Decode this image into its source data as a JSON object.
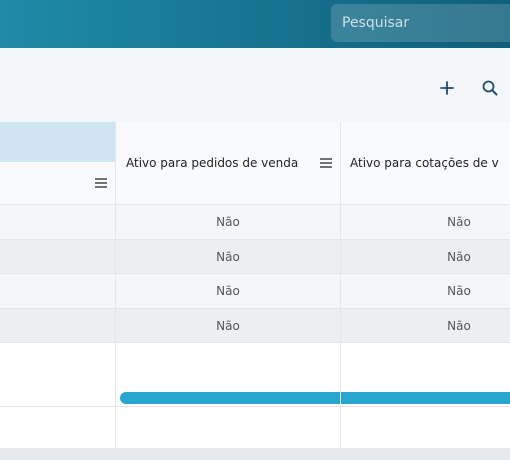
{
  "search": {
    "placeholder": "Pesquisar"
  },
  "toolbar": {
    "add_icon": "plus-icon",
    "search_icon": "magnifier-icon"
  },
  "grid": {
    "columns": [
      {
        "label": ""
      },
      {
        "label": "Ativo para pedidos de venda"
      },
      {
        "label": "Ativo para cotações de v"
      }
    ],
    "rows": [
      {
        "cells": [
          "",
          "Não",
          "Não"
        ]
      },
      {
        "cells": [
          "",
          "Não",
          "Não"
        ]
      },
      {
        "cells": [
          "",
          "Não",
          "Não"
        ]
      },
      {
        "cells": [
          "",
          "Não",
          "Não"
        ]
      }
    ]
  },
  "colors": {
    "header_start": "#1f8ba6",
    "header_end": "#0f5f7b",
    "scrollbar": "#27a5d0",
    "selected_header": "#cfe6f2"
  }
}
